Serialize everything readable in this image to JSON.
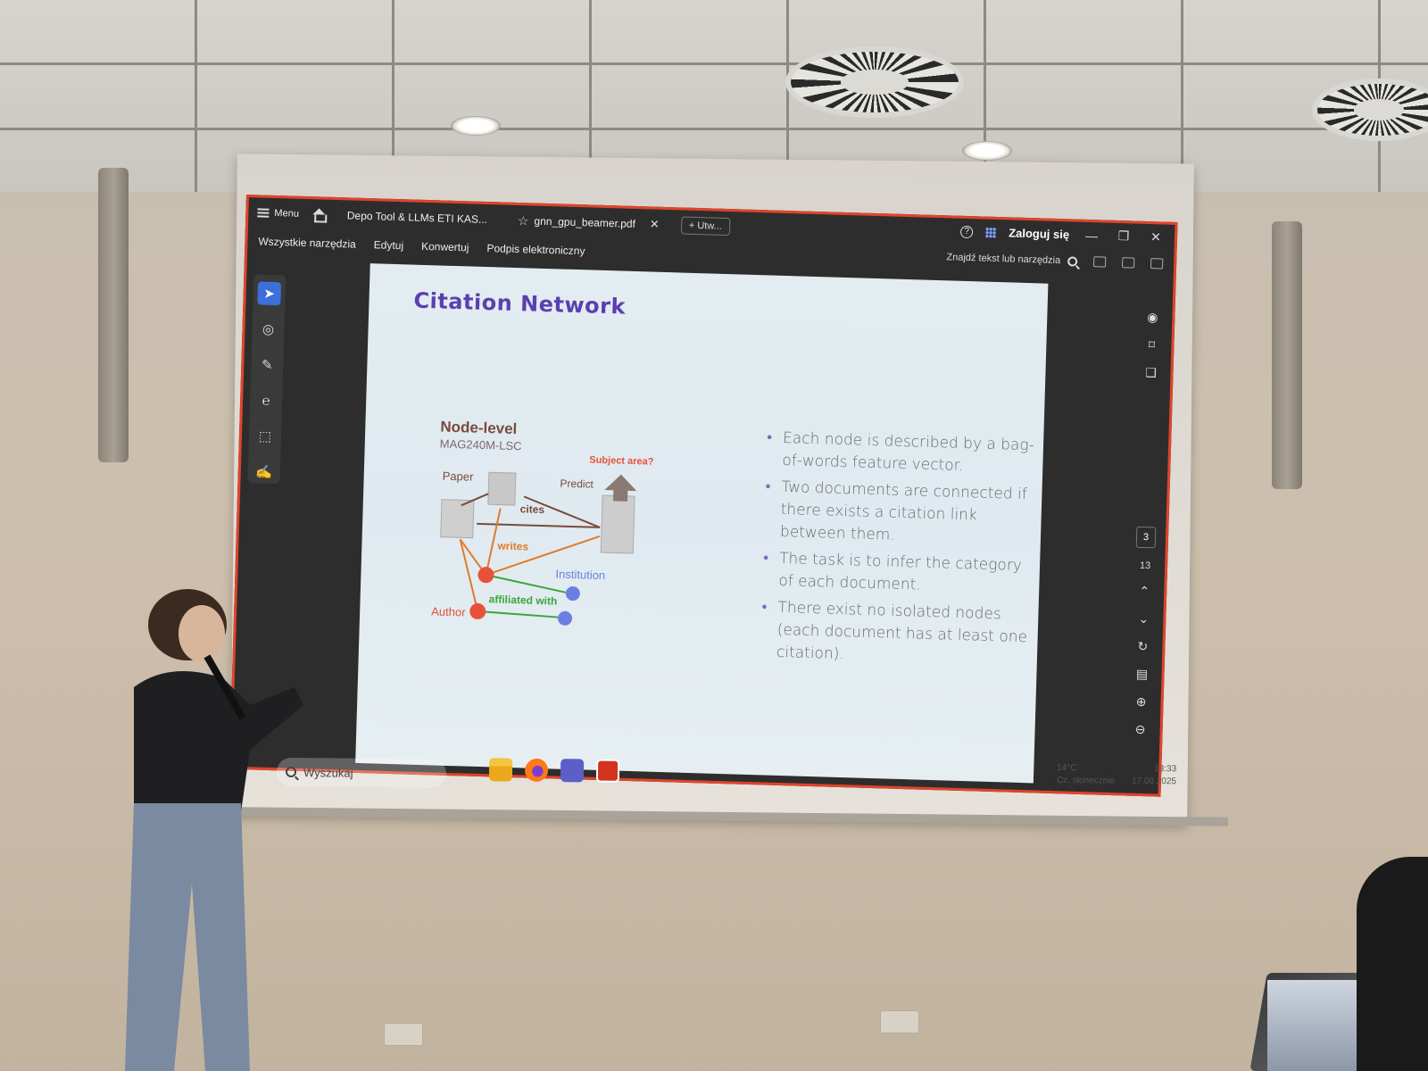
{
  "titlebar": {
    "menu_label": "Menu",
    "tabs": [
      {
        "label": "Depo Tool & LLMs ETI KAS..."
      },
      {
        "label": "gnn_gpu_beamer.pdf"
      }
    ],
    "new_tab_label": "+ Utw...",
    "sign_in_label": "Zaloguj się"
  },
  "menubar": {
    "items": [
      "Wszystkie narzędzia",
      "Edytuj",
      "Konwertuj",
      "Podpis elektroniczny"
    ],
    "search_label": "Znajdź tekst lub narzędzia"
  },
  "slide": {
    "title": "Citation Network",
    "diagram": {
      "heading": "Node-level",
      "subheading": "MAG240M-LSC",
      "paper_label": "Paper",
      "subject_label": "Subject area?",
      "predict_label": "Predict",
      "cites_label": "cites",
      "writes_label": "writes",
      "institution_label": "Institution",
      "affiliated_label": "affiliated with",
      "author_label": "Author"
    },
    "bullets": [
      "Each node is described by a bag-of-words feature vector.",
      "Two documents are connected if there exists a citation link between them.",
      "The task is to infer the category of each document.",
      "There exist no isolated nodes (each document has at least one citation)."
    ]
  },
  "page_nav": {
    "current_page": "3",
    "total_pages": "13"
  },
  "taskbar": {
    "search_placeholder": "Wyszukaj",
    "weather_temp": "14°C",
    "weather_desc": "Cz. słonecznie",
    "time": "13:33",
    "date": "17.09.2025"
  },
  "colors": {
    "accent_red": "#e0442a",
    "title_purple": "#5b3fb0",
    "author_red": "#e8503a",
    "institution_blue": "#6b7fe0",
    "affiliated_green": "#3aa63a",
    "writes_orange": "#e07a2a",
    "cites_brown": "#7a4a3a"
  }
}
